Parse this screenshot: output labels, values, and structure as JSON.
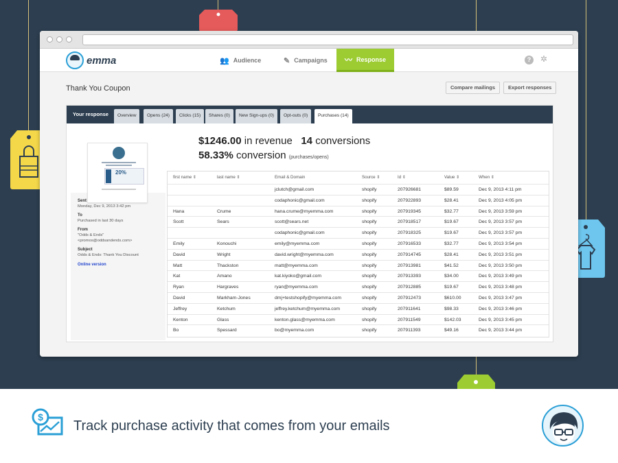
{
  "colors": {
    "background": "#2c3e50",
    "accent_green": "#9ccc32",
    "accent_blue": "#2a9fd6",
    "tag_red": "#e55a5a",
    "tag_yellow": "#f5d84a",
    "tag_lightblue": "#6ec6ee",
    "tag_green": "#9ccc32"
  },
  "nav": {
    "logo_text": "emma",
    "items": [
      {
        "label": "Audience",
        "icon": "audience-icon"
      },
      {
        "label": "Campaigns",
        "icon": "campaigns-icon"
      },
      {
        "label": "Response",
        "icon": "response-icon"
      }
    ]
  },
  "page": {
    "title": "Thank You Coupon",
    "compare_label": "Compare mailings",
    "export_label": "Export responses"
  },
  "tabs": {
    "header": "Your response",
    "items": [
      "Overview",
      "Opens (24)",
      "Clicks (15)",
      "Shares (0)",
      "New Sign-ups (0)",
      "Opt-outs (0)",
      "Purchases (14)"
    ]
  },
  "stats": {
    "revenue_value": "$1246.00",
    "revenue_label": "in revenue",
    "conversions_value": "14",
    "conversions_label": "conversions",
    "conversion_rate": "58.33%",
    "conversion_label": "conversion",
    "conversion_note": "(purchases/opens)"
  },
  "mailing": {
    "preview_percent": "20%",
    "sent_label": "Sent",
    "sent_value": "Monday, Dec 9, 2013 3:42 pm",
    "to_label": "To",
    "to_value": "Purchased in last 30 days",
    "from_label": "From",
    "from_name": "\"Odds & Ends\"",
    "from_email": "<promos@oddsandends.com>",
    "subject_label": "Subject",
    "subject_value": "Odds & Ends: Thank You Discount",
    "online_version": "Online version"
  },
  "table": {
    "headers": [
      "first name ⇕",
      "last name ⇕",
      "Email  &  Domain",
      "Source ⇕",
      "Id ⇕",
      "Value ⇕",
      "When ⇕"
    ],
    "rows": [
      [
        "",
        "",
        "jclutch@gmail.com",
        "shopify",
        "207926681",
        "$89.59",
        "Dec 9, 2013 4:11 pm"
      ],
      [
        "",
        "",
        "codaphonic@gmail.com",
        "shopify",
        "207922893",
        "$28.41",
        "Dec 9, 2013 4:05 pm"
      ],
      [
        "Hana",
        "Crume",
        "hana.crume@myemma.com",
        "shopify",
        "207919345",
        "$32.77",
        "Dec 9, 2013 3:59 pm"
      ],
      [
        "Scott",
        "Sears",
        "scott@sears.net",
        "shopify",
        "207918517",
        "$19.67",
        "Dec 9, 2013 3:57 pm"
      ],
      [
        "",
        "",
        "codaphonic@gmail.com",
        "shopify",
        "207918325",
        "$19.67",
        "Dec 9, 2013 3:57 pm"
      ],
      [
        "Emily",
        "Konouchi",
        "emily@myemma.com",
        "shopify",
        "207916533",
        "$32.77",
        "Dec 9, 2013 3:54 pm"
      ],
      [
        "David",
        "Wright",
        "david.wright@myemma.com",
        "shopify",
        "207914745",
        "$28.41",
        "Dec 9, 2013 3:51 pm"
      ],
      [
        "Matt",
        "Thackston",
        "matt@myemma.com",
        "shopify",
        "207913981",
        "$41.52",
        "Dec 9, 2013 3:50 pm"
      ],
      [
        "Kat",
        "Amano",
        "kat.kiyoko@gmail.com",
        "shopify",
        "207913393",
        "$34.00",
        "Dec 9, 2013 3:49 pm"
      ],
      [
        "Ryan",
        "Hargraves",
        "ryan@myemma.com",
        "shopify",
        "207912885",
        "$19.67",
        "Dec 9, 2013 3:48 pm"
      ],
      [
        "David",
        "Markham-Jones",
        "dmj+testshopify@myemma.com",
        "shopify",
        "207912473",
        "$610.00",
        "Dec 9, 2013 3:47 pm"
      ],
      [
        "Jeffrey",
        "Ketchum",
        "jeffrey.ketchum@myemma.com",
        "shopify",
        "207911641",
        "$98.33",
        "Dec 9, 2013 3:46 pm"
      ],
      [
        "Kenton",
        "Glass",
        "kenton.glass@myemma.com",
        "shopify",
        "207911549",
        "$142.03",
        "Dec 9, 2013 3:45 pm"
      ],
      [
        "Bo",
        "Spessard",
        "bo@myemma.com",
        "shopify",
        "207911393",
        "$49.16",
        "Dec 9, 2013 3:44 pm"
      ]
    ]
  },
  "footer": {
    "tagline": "Track purchase activity that comes from your emails"
  }
}
